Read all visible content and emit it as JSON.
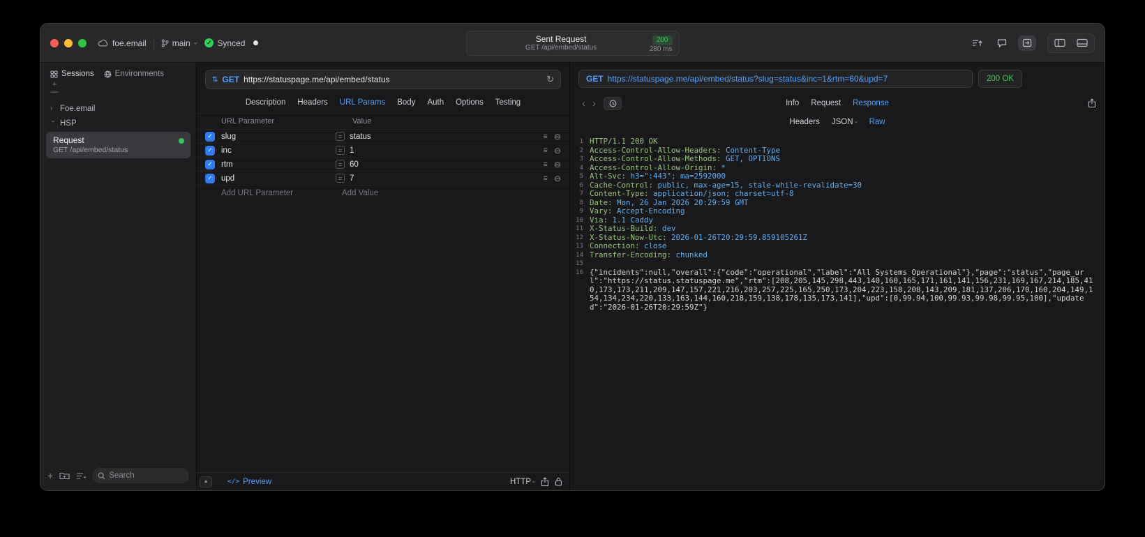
{
  "titlebar": {
    "project": "foe.email",
    "branch": "main",
    "sync_status": "Synced",
    "center": {
      "title": "Sent Request",
      "subtitle": "GET /api/embed/status",
      "status_code": "200",
      "duration": "280 ms"
    }
  },
  "sidebar": {
    "tabs": [
      {
        "label": "Sessions",
        "active": true
      },
      {
        "label": "Environments",
        "active": false
      }
    ],
    "tree": [
      {
        "label": "Foe.email",
        "expanded": false
      },
      {
        "label": "HSP",
        "expanded": true
      }
    ],
    "request_item": {
      "title": "Request",
      "subtitle": "GET /api/embed/status",
      "selected": true
    },
    "search_placeholder": "Search"
  },
  "request_panel": {
    "method": "GET",
    "url": "https://statuspage.me/api/embed/status",
    "tabs": [
      {
        "label": "Description"
      },
      {
        "label": "Headers"
      },
      {
        "label": "URL Params",
        "active": true
      },
      {
        "label": "Body"
      },
      {
        "label": "Auth"
      },
      {
        "label": "Options"
      },
      {
        "label": "Testing"
      }
    ],
    "table": {
      "columns": [
        "URL Parameter",
        "Value"
      ],
      "rows": [
        {
          "name": "slug",
          "value": "status",
          "checked": true
        },
        {
          "name": "inc",
          "value": "1",
          "checked": true
        },
        {
          "name": "rtm",
          "value": "60",
          "checked": true
        },
        {
          "name": "upd",
          "value": "7",
          "checked": true
        }
      ],
      "add_row": {
        "name_placeholder": "Add URL Parameter",
        "value_placeholder": "Add Value"
      }
    },
    "footer": {
      "preview": "Preview",
      "protocol": "HTTP"
    }
  },
  "response_panel": {
    "request_line": {
      "method": "GET",
      "url": "https://statuspage.me/api/embed/status?slug=status&inc=1&rtm=60&upd=7"
    },
    "status": "200 OK",
    "tabs": [
      {
        "label": "Info"
      },
      {
        "label": "Request"
      },
      {
        "label": "Response",
        "active": true
      }
    ],
    "subtabs": [
      {
        "label": "Headers"
      },
      {
        "label": "JSON",
        "menu": true
      },
      {
        "label": "Raw",
        "active": true
      }
    ],
    "lines": [
      {
        "n": "1",
        "k": "HTTP/1.1 200 OK",
        "v": ""
      },
      {
        "n": "2",
        "k": "Access-Control-Allow-Headers:",
        "v": "Content-Type"
      },
      {
        "n": "3",
        "k": "Access-Control-Allow-Methods:",
        "v": "GET, OPTIONS"
      },
      {
        "n": "4",
        "k": "Access-Control-Allow-Origin:",
        "v": "*"
      },
      {
        "n": "5",
        "k": "Alt-Svc:",
        "v": "h3=\":443\"; ma=2592000"
      },
      {
        "n": "6",
        "k": "Cache-Control:",
        "v": "public, max-age=15, stale-while-revalidate=30"
      },
      {
        "n": "7",
        "k": "Content-Type:",
        "v": "application/json; charset=utf-8"
      },
      {
        "n": "8",
        "k": "Date:",
        "v": "Mon, 26 Jan 2026 20:29:59 GMT"
      },
      {
        "n": "9",
        "k": "Vary:",
        "v": "Accept-Encoding"
      },
      {
        "n": "10",
        "k": "Via:",
        "v": "1.1 Caddy"
      },
      {
        "n": "11",
        "k": "X-Status-Build:",
        "v": "dev"
      },
      {
        "n": "12",
        "k": "X-Status-Now-Utc:",
        "v": "2026-01-26T20:29:59.859105261Z"
      },
      {
        "n": "13",
        "k": "Connection:",
        "v": "close"
      },
      {
        "n": "14",
        "k": "Transfer-Encoding:",
        "v": "chunked"
      },
      {
        "n": "15",
        "k": "",
        "v": ""
      },
      {
        "n": "16",
        "body": "{\"incidents\":null,\"overall\":{\"code\":\"operational\",\"label\":\"All Systems Operational\"},\"page\":\"status\",\"page_url\":\"https://status.statuspage.me\",\"rtm\":[208,205,145,298,443,140,160,165,171,161,141,156,231,169,167,214,185,410,173,173,211,209,147,157,221,216,203,257,225,165,250,173,204,223,158,208,143,209,181,137,206,170,160,204,149,154,134,234,220,133,163,144,160,218,159,138,178,135,173,141],\"upd\":[0,99.94,100,99.93,99.98,99.95,100],\"updated\":\"2026-01-26T20:29:59Z\"}"
      }
    ]
  }
}
